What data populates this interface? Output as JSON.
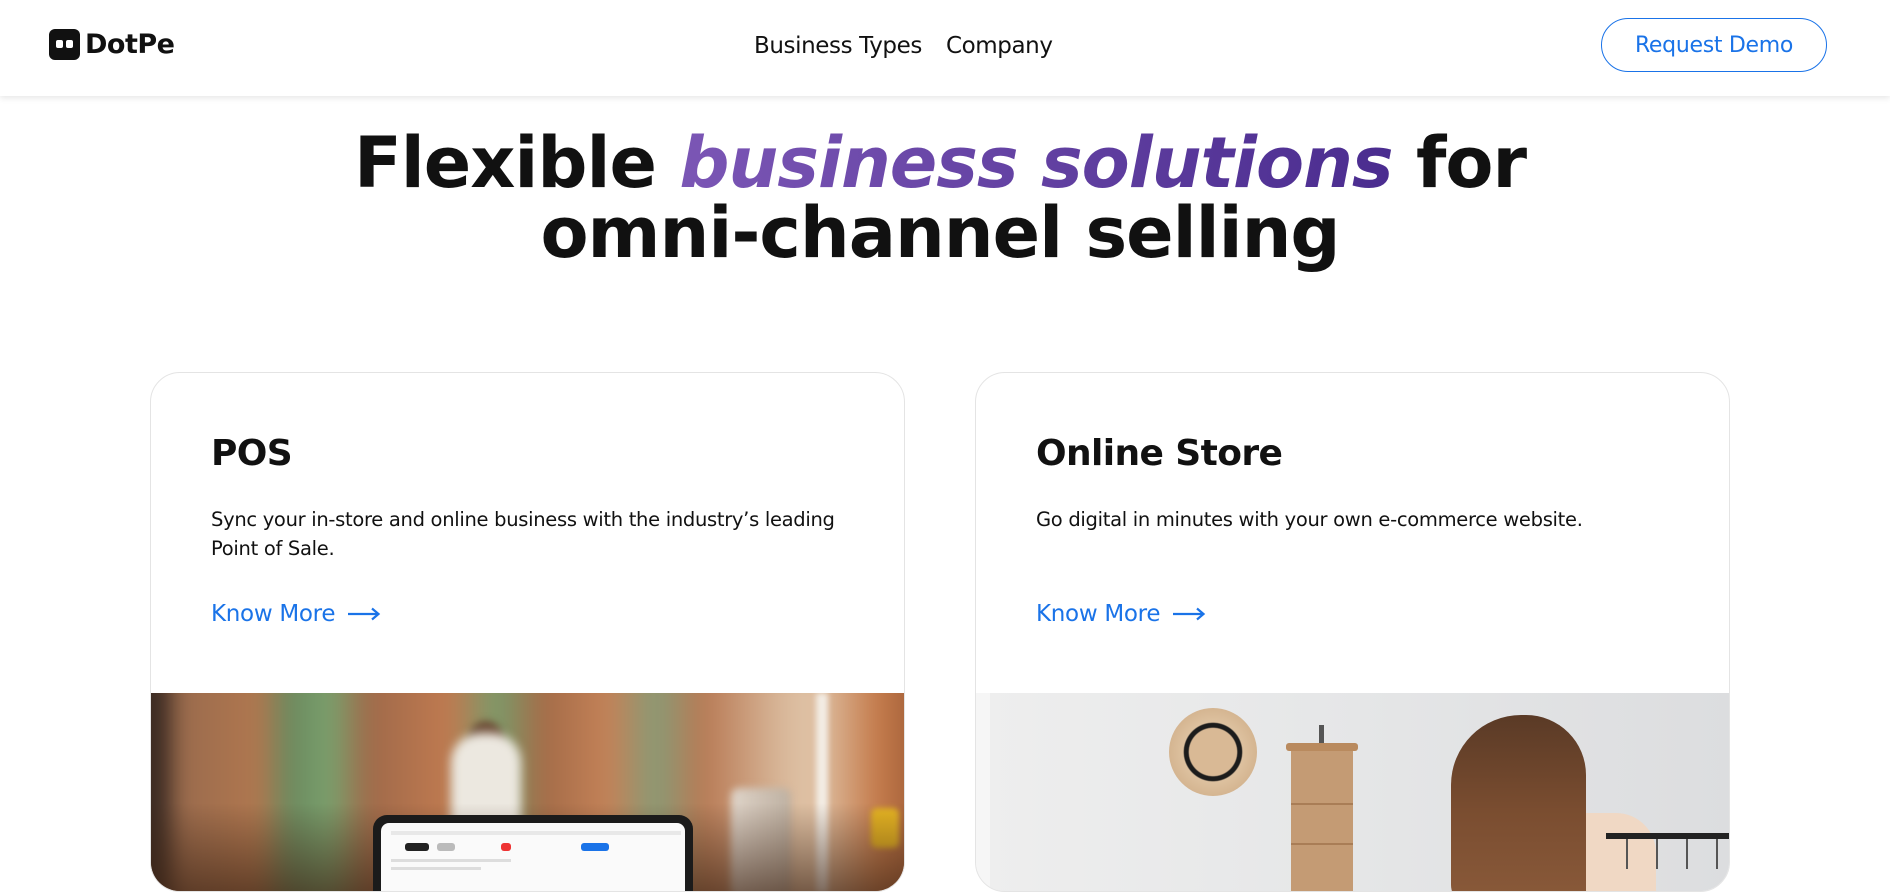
{
  "header": {
    "logo_text": "DotPe",
    "nav": [
      {
        "label": "Business Types"
      },
      {
        "label": "Company"
      }
    ],
    "cta_label": "Request Demo"
  },
  "hero": {
    "line1_start": "Flexible ",
    "line1_accent": "business solutions",
    "line1_end": " for",
    "line2": "omni-channel selling"
  },
  "cards": [
    {
      "title": "POS",
      "description": "Sync your in-store and online business with the industry’s leading Point of Sale.",
      "link_label": "Know More",
      "image": "restaurant-pos-photo"
    },
    {
      "title": "Online Store",
      "description": "Go digital in minutes with your own e-commerce website.",
      "link_label": "Know More",
      "image": "online-store-photo"
    }
  ],
  "colors": {
    "link": "#1a73e8",
    "accent_start": "#7b56b5",
    "accent_end": "#4a2c8f",
    "text": "#111111"
  },
  "icons": [
    "logo-icon",
    "arrow-right-icon"
  ]
}
